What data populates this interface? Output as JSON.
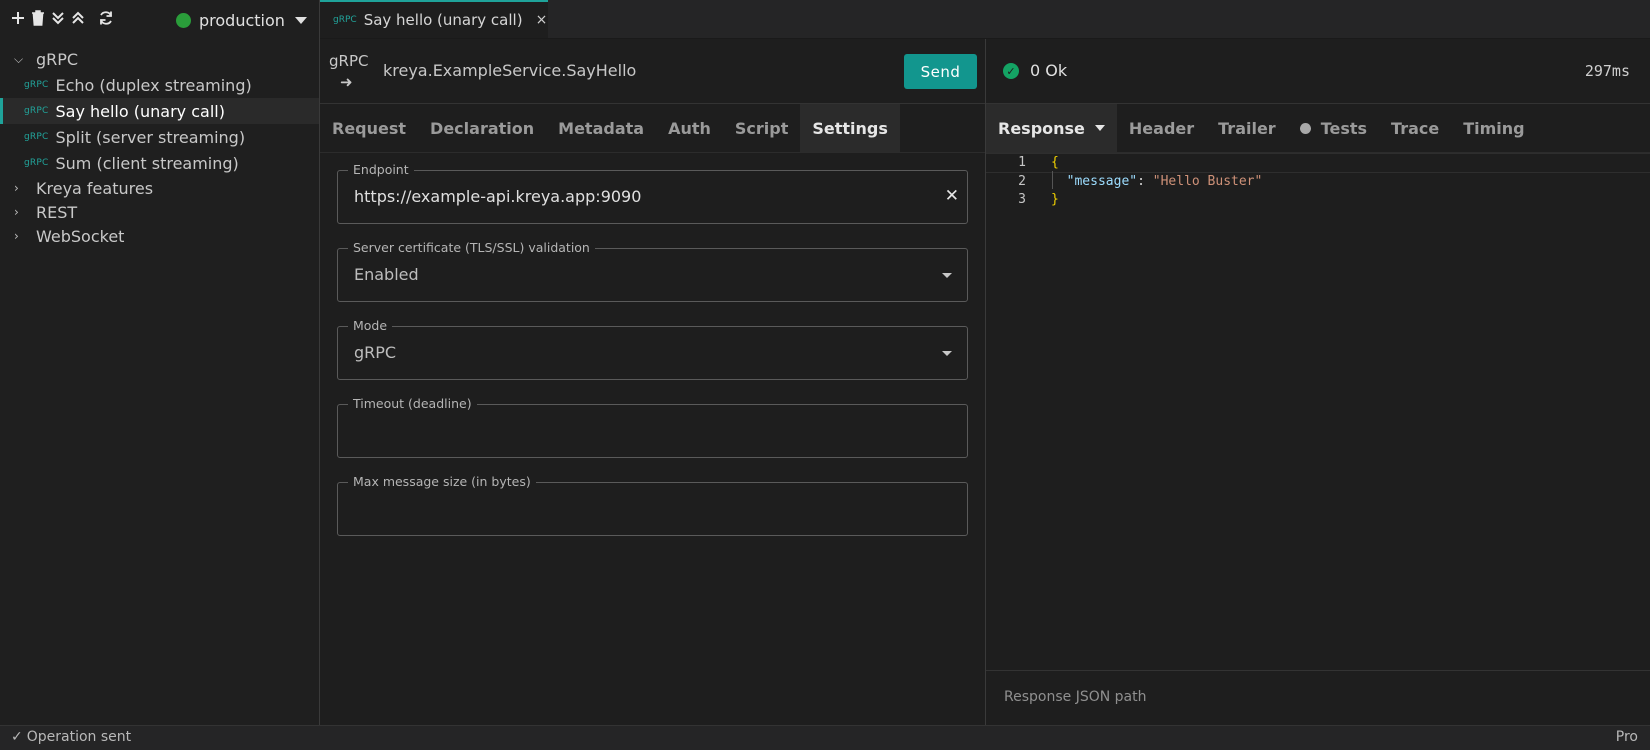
{
  "sidebar": {
    "environment": "production",
    "tree": [
      {
        "label": "gRPC",
        "type": "folder",
        "expanded": true
      },
      {
        "label": "Echo (duplex streaming)",
        "type": "op",
        "tag": "gRPC"
      },
      {
        "label": "Say hello (unary call)",
        "type": "op",
        "tag": "gRPC",
        "active": true
      },
      {
        "label": "Split (server streaming)",
        "type": "op",
        "tag": "gRPC"
      },
      {
        "label": "Sum (client streaming)",
        "type": "op",
        "tag": "gRPC"
      },
      {
        "label": "Kreya features",
        "type": "folder",
        "expanded": false
      },
      {
        "label": "REST",
        "type": "folder",
        "expanded": false
      },
      {
        "label": "WebSocket",
        "type": "folder",
        "expanded": false
      }
    ]
  },
  "tab": {
    "tag": "gRPC",
    "label": "Say hello (unary call)",
    "close": "×"
  },
  "request": {
    "kind": "gRPC",
    "arrow": "➜",
    "method": "kreya.ExampleService.SayHello",
    "send": "Send",
    "tabs": [
      "Request",
      "Declaration",
      "Metadata",
      "Auth",
      "Script",
      "Settings"
    ],
    "active_tab": "Settings",
    "settings": {
      "endpoint": {
        "label": "Endpoint",
        "value": "https://example-api.kreya.app:9090"
      },
      "tls": {
        "label": "Server certificate (TLS/SSL) validation",
        "value": "Enabled"
      },
      "mode": {
        "label": "Mode",
        "value": "gRPC"
      },
      "timeout": {
        "label": "Timeout (deadline)",
        "value": ""
      },
      "max_size": {
        "label": "Max message size (in bytes)",
        "value": ""
      }
    }
  },
  "response": {
    "status": "0 Ok",
    "duration": "297ms",
    "tabs": [
      "Response",
      "Header",
      "Trailer",
      "Tests",
      "Trace",
      "Timing"
    ],
    "active_tab": "Response",
    "code": {
      "lines": [
        "1",
        "2",
        "3"
      ],
      "open": "{",
      "key": "\"message\"",
      "colon": ": ",
      "value": "\"Hello Buster\"",
      "close": "}"
    },
    "json_path_placeholder": "Response JSON path"
  },
  "status_bar": {
    "left": "Operation sent",
    "right": "Pro"
  },
  "colors": {
    "accent": "#12968e",
    "env_dot": "#2a9d3a",
    "ok": "#14a364"
  }
}
